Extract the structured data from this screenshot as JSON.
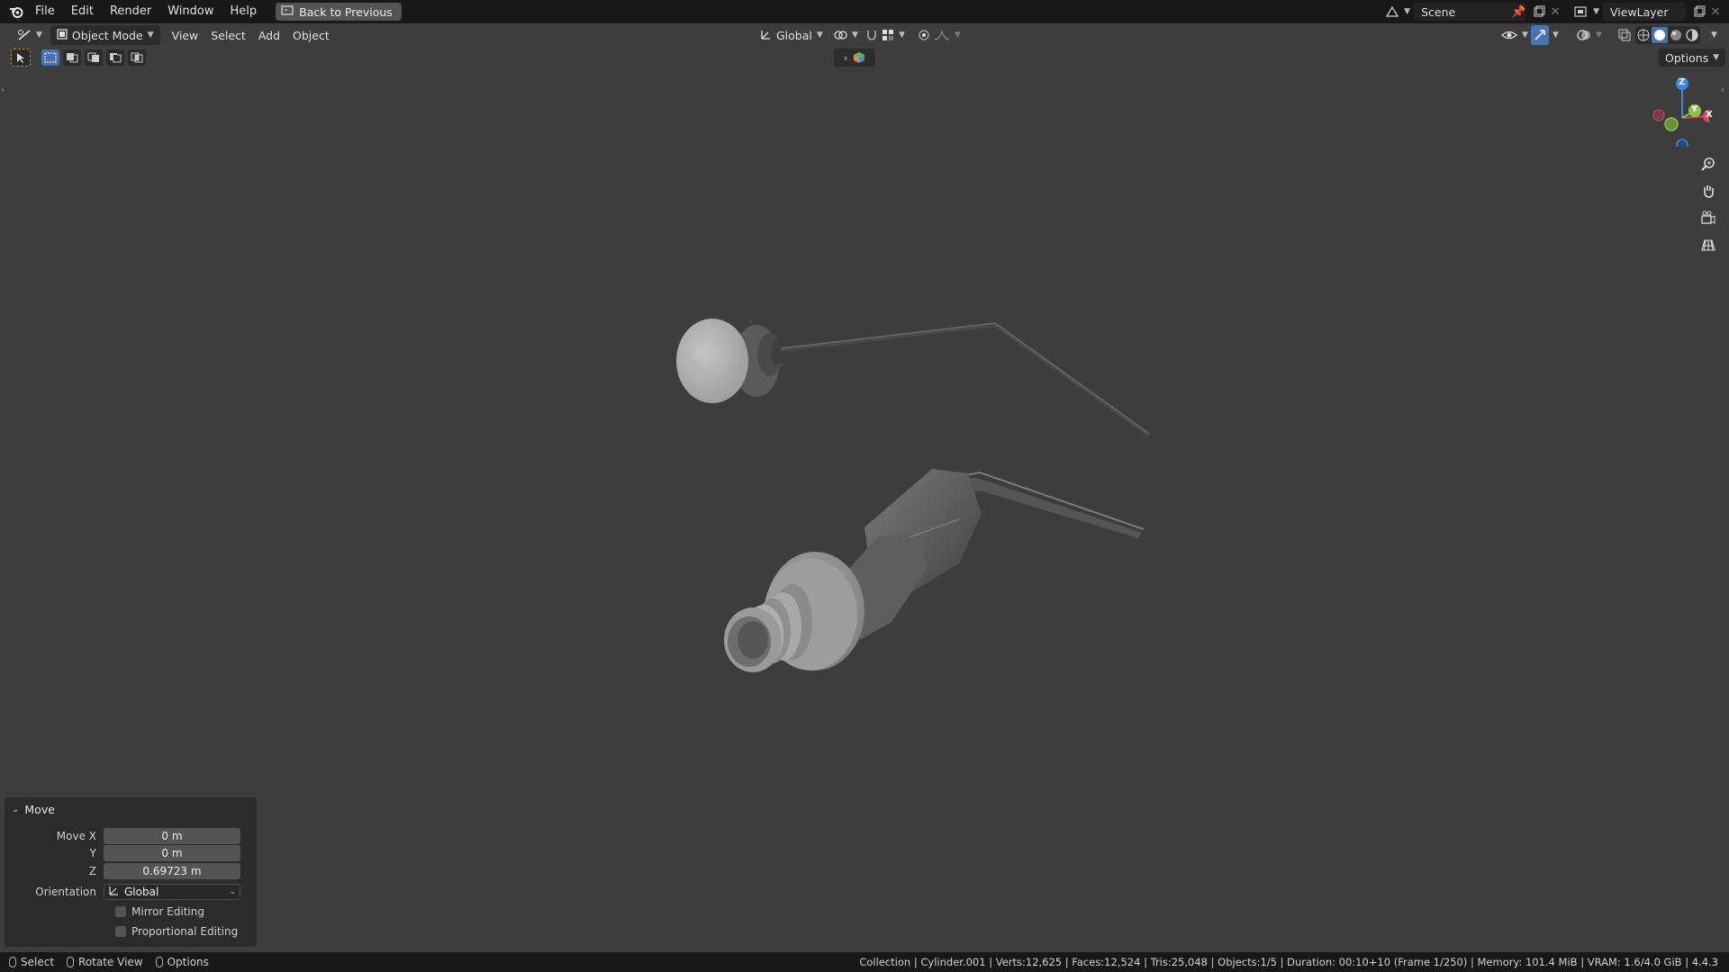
{
  "topbar": {
    "menus": [
      "File",
      "Edit",
      "Render",
      "Window",
      "Help"
    ],
    "back_button": "Back to Previous",
    "scene": "Scene",
    "view_layer": "ViewLayer"
  },
  "header": {
    "mode": "Object Mode",
    "menus": [
      "View",
      "Select",
      "Add",
      "Object"
    ],
    "orientation": "Global",
    "options": "Options"
  },
  "gizmo": {
    "z": "Z",
    "y": "Y",
    "x": "X"
  },
  "move_panel": {
    "title": "Move",
    "move_x_label": "Move X",
    "move_x": "0 m",
    "y_label": "Y",
    "y": "0 m",
    "z_label": "Z",
    "z": "0.69723 m",
    "orientation_label": "Orientation",
    "orientation": "Global",
    "mirror_editing": "Mirror Editing",
    "proportional_editing": "Proportional Editing"
  },
  "statusbar": {
    "select": "Select",
    "rotate_view": "Rotate View",
    "options": "Options",
    "info": "Collection | Cylinder.001 | Verts:12,625 | Faces:12,524 | Tris:25,048 | Objects:1/5 | Duration: 00:10+10 (Frame 1/250) | Memory: 101.4 MiB | VRAM: 1.6/4.0 GiB | 4.4.3"
  },
  "colors": {
    "accent": "#4772b3",
    "axis_x": "#e5475a",
    "axis_y": "#8bc34a",
    "axis_z": "#3f86e0"
  }
}
